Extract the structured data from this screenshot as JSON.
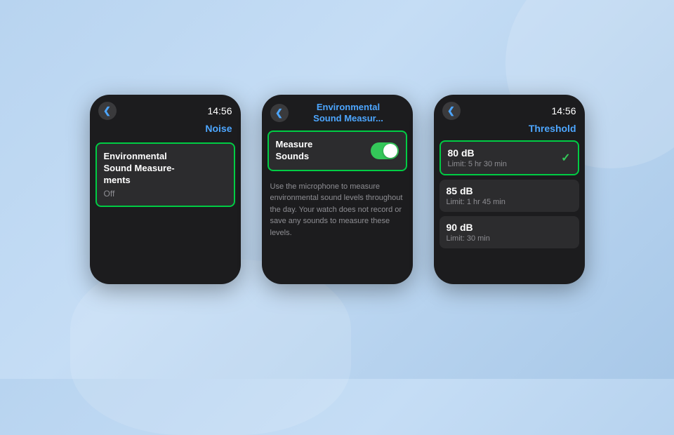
{
  "background": {
    "color_start": "#b8d4f0",
    "color_end": "#a8c8e8"
  },
  "screen1": {
    "time": "14:56",
    "back_label": "<",
    "title": "Noise",
    "menu_item": {
      "line1": "Environmental",
      "line2": "Sound Measure-",
      "line3": "ments",
      "status": "Off"
    }
  },
  "screen2": {
    "back_label": "<",
    "title_line1": "Environmental",
    "title_line2": "Sound Measur...",
    "toggle_label_line1": "Measure",
    "toggle_label_line2": "Sounds",
    "toggle_state": "on",
    "description": "Use the microphone to measure environmental sound levels throughout the day. Your watch does not record or save any sounds to measure these levels."
  },
  "screen3": {
    "time": "14:56",
    "back_label": "<",
    "title": "Threshold",
    "thresholds": [
      {
        "db": "80 dB",
        "limit": "Limit: 5 hr 30 min",
        "selected": true
      },
      {
        "db": "85 dB",
        "limit": "Limit: 1 hr 45 min",
        "selected": false
      },
      {
        "db": "90 dB",
        "limit": "Limit: 30 min",
        "selected": false
      }
    ]
  },
  "icons": {
    "back": "❮",
    "checkmark": "✓"
  }
}
